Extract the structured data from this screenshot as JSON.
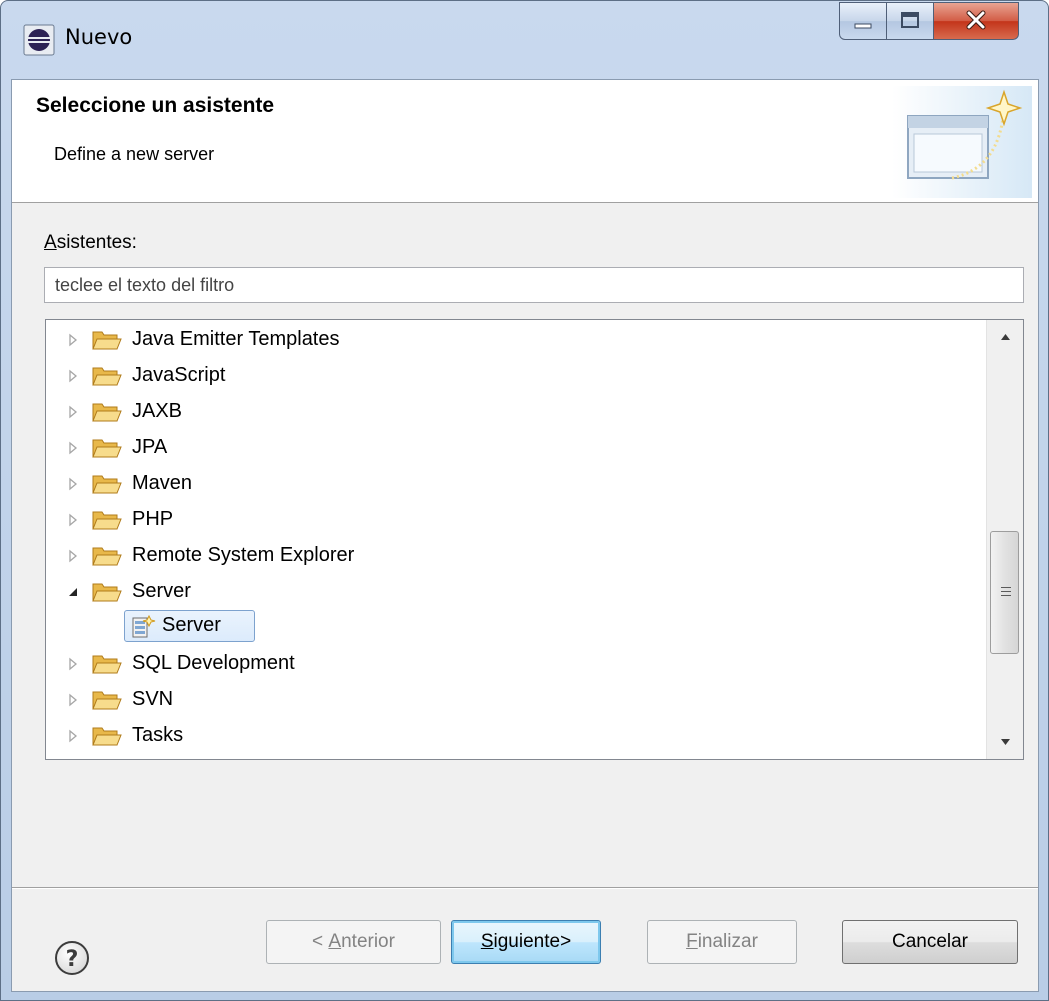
{
  "window": {
    "title": "Nuevo",
    "controls": {
      "minimize": "minimize",
      "maximize": "maximize",
      "close": "close"
    }
  },
  "banner": {
    "title": "Seleccione un asistente",
    "description": "Define a new server",
    "icon": "new-wizard-icon"
  },
  "wizards": {
    "label_first": "A",
    "label_rest": "sistentes:",
    "filter_placeholder": "teclee el texto del filtro"
  },
  "tree": {
    "items": [
      {
        "label": "Java Emitter Templates",
        "expanded": false
      },
      {
        "label": "JavaScript",
        "expanded": false
      },
      {
        "label": "JAXB",
        "expanded": false
      },
      {
        "label": "JPA",
        "expanded": false
      },
      {
        "label": "Maven",
        "expanded": false
      },
      {
        "label": "PHP",
        "expanded": false
      },
      {
        "label": "Remote System Explorer",
        "expanded": false
      },
      {
        "label": "Server",
        "expanded": true
      },
      {
        "label": "Server",
        "child": true,
        "selected": true
      },
      {
        "label": "SQL Development",
        "expanded": false
      },
      {
        "label": "SVN",
        "expanded": false
      },
      {
        "label": "Tasks",
        "expanded": false
      }
    ]
  },
  "buttons": {
    "back": {
      "prefix": "< ",
      "mnemonic": "A",
      "rest": "nterior",
      "enabled": false
    },
    "next": {
      "mnemonic": "S",
      "rest": "iguiente>",
      "enabled": true
    },
    "finish": {
      "mnemonic": "F",
      "rest": "inalizar",
      "enabled": false
    },
    "cancel": {
      "label": "Cancelar",
      "enabled": true
    }
  },
  "colors": {
    "accent": "#3c7fb1",
    "selection": "#dcebfc",
    "folder": "#e8b84a"
  }
}
